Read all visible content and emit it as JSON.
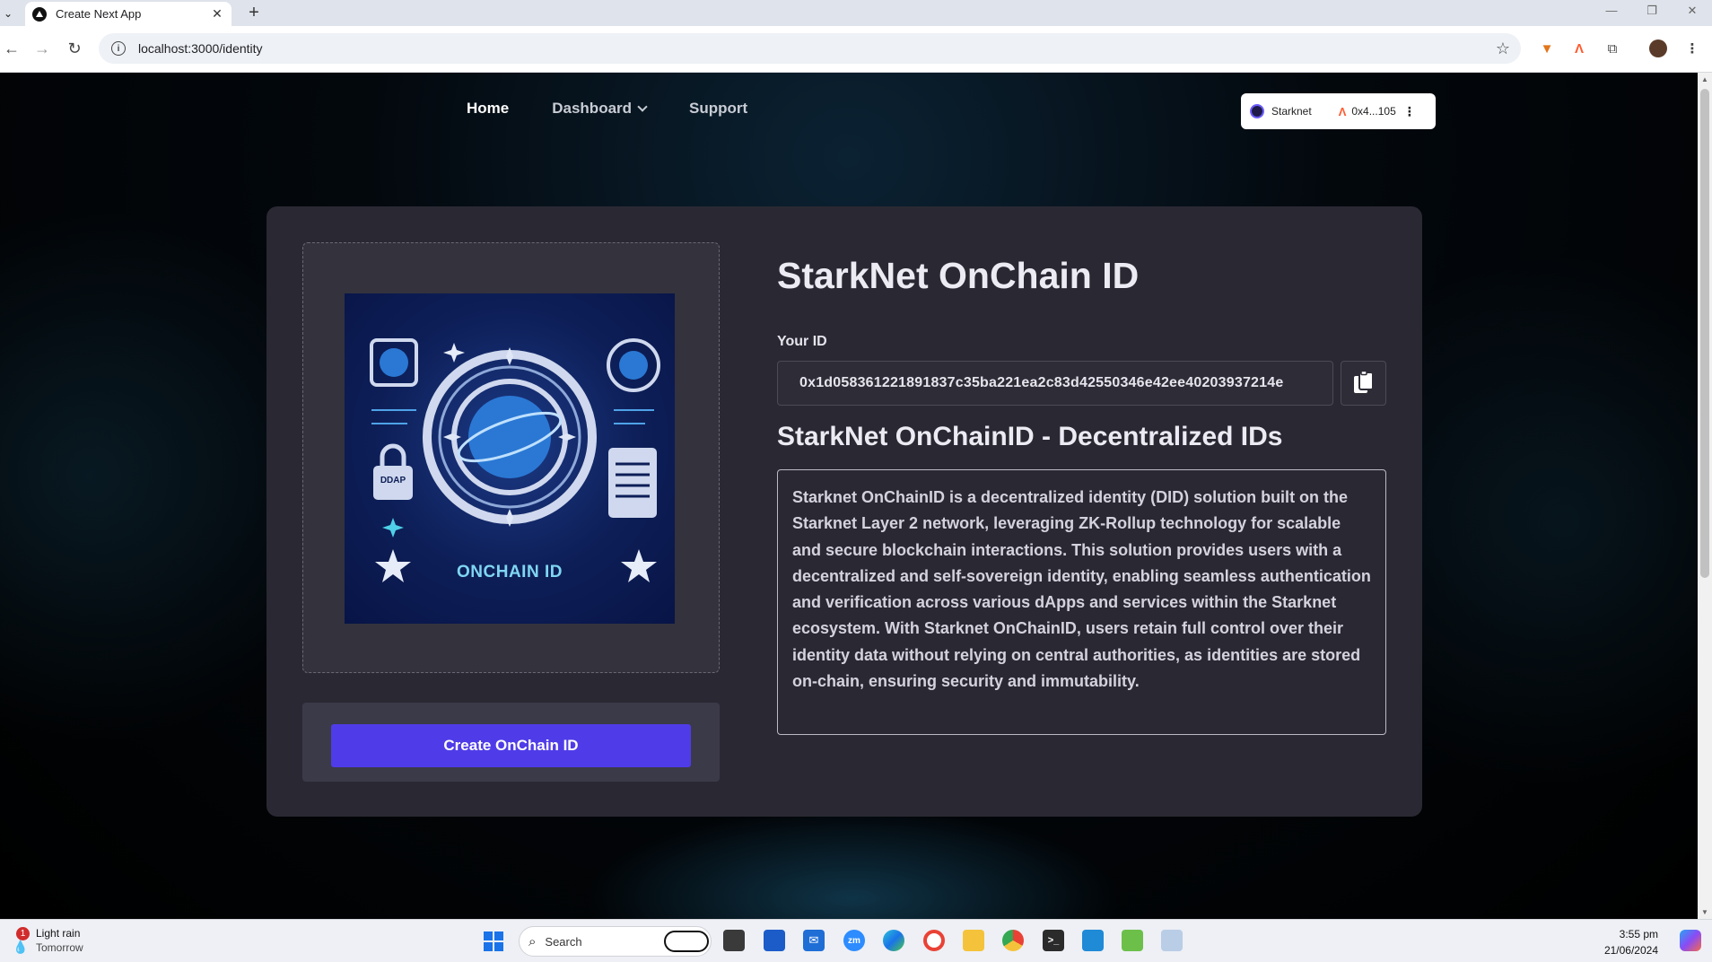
{
  "browser": {
    "tab_title": "Create Next App",
    "tab_close": "✕",
    "new_tab": "+",
    "url": "localhost:3000/identity",
    "window_controls": {
      "minimize": "—",
      "restore": "❐",
      "close": "✕"
    }
  },
  "nav": {
    "items": [
      {
        "label": "Home",
        "active": true
      },
      {
        "label": "Dashboard",
        "has_dropdown": true
      },
      {
        "label": "Support"
      }
    ]
  },
  "wallet": {
    "network": "Starknet",
    "address": "0x4...105",
    "menu_icon": "⋮"
  },
  "identity": {
    "image_caption": "ONCHAIN ID",
    "image_badge": "DDAP",
    "title": "StarkNet OnChain ID",
    "id_label": "Your ID",
    "id_value": "0x1d058361221891837c35ba221ea2c83d42550346e42ee40203937214e",
    "subtitle": "StarkNet OnChainID - Decentralized IDs",
    "description": "Starknet OnChainID is a decentralized identity (DID) solution built on the Starknet Layer 2 network, leveraging ZK-Rollup technology for scalable and secure blockchain interactions. This solution provides users with a decentralized and self-sovereign identity, enabling seamless authentication and verification across various dApps and services within the Starknet ecosystem. With Starknet OnChainID, users retain full control over their identity data without relying on central authorities, as identities are stored on-chain, ensuring security and immutability.",
    "create_button": "Create OnChain ID"
  },
  "taskbar": {
    "weather_title": "Light rain",
    "weather_sub": "Tomorrow",
    "weather_badge": "1",
    "search_placeholder": "Search",
    "time": "3:55 pm",
    "date": "21/06/2024"
  },
  "colors": {
    "accent": "#4f3ce8",
    "card": "#2a2933",
    "page_bg": "#000000"
  }
}
